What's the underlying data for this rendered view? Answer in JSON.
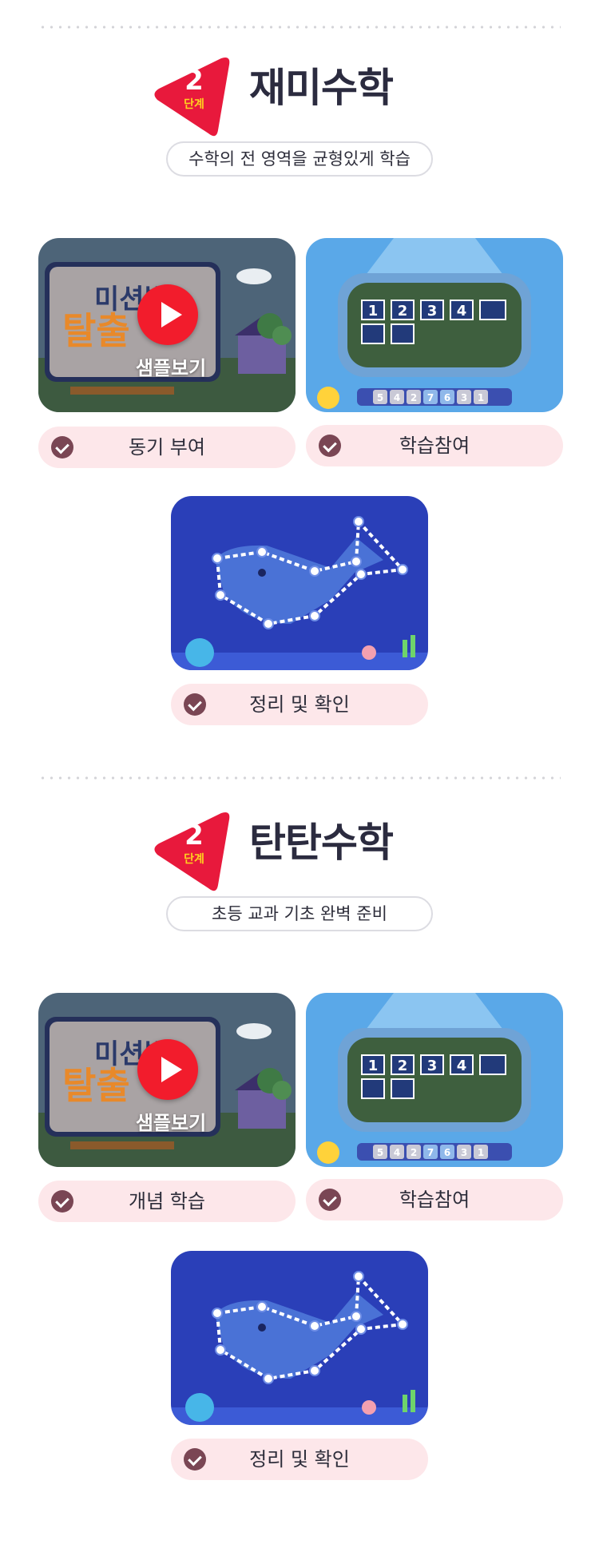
{
  "sections": [
    {
      "badge_number": "2",
      "badge_sub": "단계",
      "title": "재미수학",
      "subtitle": "수학의 전 영역을 균형있게 학습",
      "sample_label": "샘플보기",
      "steps": [
        "동기 부여",
        "학습참여",
        "정리 및 확인"
      ]
    },
    {
      "badge_number": "2",
      "badge_sub": "단계",
      "title": "탄탄수학",
      "subtitle": "초등 교과 기초 완벽 준비",
      "sample_label": "샘플보기",
      "steps": [
        "개념 학습",
        "학습참여",
        "정리 및 확인"
      ]
    }
  ],
  "thumbnail_text": {
    "mission_line1": "미션빌",
    "mission_line2": "탈출",
    "board_numbers": [
      "1",
      "2",
      "3",
      "4"
    ],
    "tile_numbers": [
      "5",
      "4",
      "2",
      "7",
      "6",
      "3",
      "1"
    ]
  },
  "colors": {
    "badge": "#e8193c",
    "badge_sub_text": "#ffd21f",
    "pill_bg": "#fde7ea",
    "check_bg": "#7a4654",
    "play_button": "#f21c2c"
  },
  "icons": [
    "play-icon",
    "check-icon",
    "step-badge-triangle"
  ]
}
